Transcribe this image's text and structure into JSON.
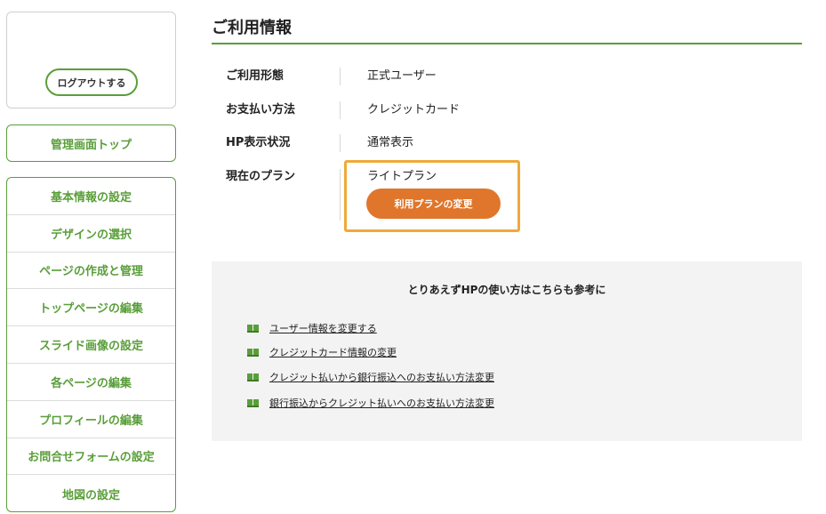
{
  "sidebar": {
    "logout_label": "ログアウトする",
    "top_label": "管理画面トップ",
    "menu": [
      "基本情報の設定",
      "デザインの選択",
      "ページの作成と管理",
      "トップページの編集",
      "スライド画像の設定",
      "各ページの編集",
      "プロフィールの編集",
      "お問合せフォームの設定",
      "地図の設定"
    ]
  },
  "main": {
    "title": "ご利用情報",
    "rows": [
      {
        "label": "ご利用形態",
        "value": "正式ユーザー"
      },
      {
        "label": "お支払い方法",
        "value": "クレジットカード"
      },
      {
        "label": "HP表示状況",
        "value": "通常表示"
      },
      {
        "label": "現在のプラン",
        "value": "ライトプラン"
      }
    ],
    "change_plan_label": "利用プランの変更",
    "help": {
      "title": "とりあえずHPの使い方はこちらも参考に",
      "links": [
        "ユーザー情報を変更する",
        "クレジットカード情報の変更",
        "クレジット払いから銀行振込へのお支払い方法変更",
        "銀行振込からクレジット払いへのお支払い方法変更"
      ]
    }
  },
  "colors": {
    "accent_green": "#5a9e3a",
    "button_orange": "#e0762b",
    "highlight_orange": "#f0a93a"
  }
}
